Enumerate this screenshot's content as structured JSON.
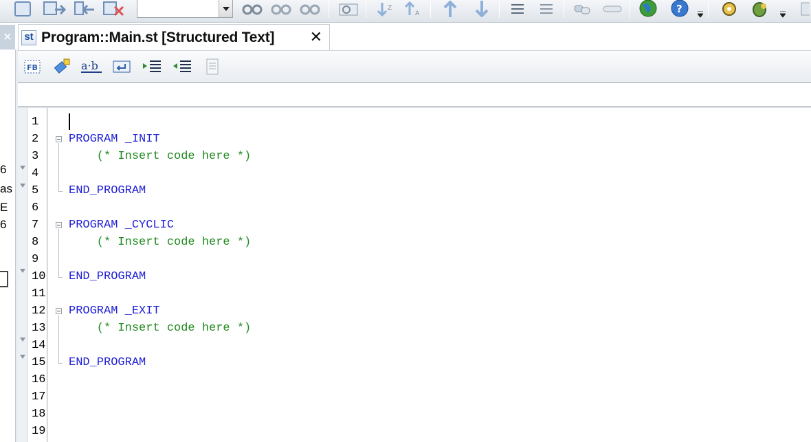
{
  "tab": {
    "icon_text": "st",
    "title": "Program::Main.st [Structured Text]",
    "close_glyph": "✕"
  },
  "left_panel": {
    "close_glyph": "✕",
    "fragments": [
      "6",
      "as",
      "E",
      "6"
    ]
  },
  "toolbar": {
    "combo_value": "",
    "icons": [
      "new-file-icon",
      "open-file-icon",
      "save-file-icon",
      "delete-icon",
      "binoculars-icon",
      "binoculars-next-icon",
      "binoculars-prev-icon",
      "find-replace-icon",
      "sort-asc-icon",
      "sort-desc-icon",
      "arrow-up-icon",
      "arrow-down-icon",
      "align-icon",
      "align-outdent-icon",
      "link-icon",
      "unlink-icon",
      "globe-icon",
      "help-icon",
      "settings-gear-icon",
      "debug-bug-icon"
    ]
  },
  "editor_toolbar": {
    "icons": [
      "function-block-icon",
      "insert-element-icon",
      "ab-rename-icon",
      "wrap-icon",
      "indent-icon",
      "outdent-icon",
      "properties-icon"
    ],
    "fb_label": "FB"
  },
  "field_bar": {
    "value": ""
  },
  "editor": {
    "line_numbers": [
      "1",
      "2",
      "3",
      "4",
      "5",
      "6",
      "7",
      "8",
      "9",
      "10",
      "11",
      "12",
      "13",
      "14",
      "15",
      "16",
      "17",
      "18",
      "19"
    ],
    "lines": [
      {
        "kind": "empty",
        "text": ""
      },
      {
        "kind": "kw",
        "text": "PROGRAM _INIT"
      },
      {
        "kind": "cm",
        "text": "    (* Insert code here *)"
      },
      {
        "kind": "empty",
        "text": ""
      },
      {
        "kind": "kw",
        "text": "END_PROGRAM"
      },
      {
        "kind": "empty",
        "text": ""
      },
      {
        "kind": "kw",
        "text": "PROGRAM _CYCLIC"
      },
      {
        "kind": "cm",
        "text": "    (* Insert code here *)"
      },
      {
        "kind": "empty",
        "text": ""
      },
      {
        "kind": "kw",
        "text": "END_PROGRAM"
      },
      {
        "kind": "empty",
        "text": ""
      },
      {
        "kind": "kw",
        "text": "PROGRAM _EXIT"
      },
      {
        "kind": "cm",
        "text": "    (* Insert code here *)"
      },
      {
        "kind": "empty",
        "text": ""
      },
      {
        "kind": "kw",
        "text": "END_PROGRAM"
      },
      {
        "kind": "empty",
        "text": ""
      },
      {
        "kind": "empty",
        "text": ""
      },
      {
        "kind": "empty",
        "text": ""
      },
      {
        "kind": "empty",
        "text": ""
      }
    ],
    "colors": {
      "keyword": "#1f1fd6",
      "comment": "#1f8a1f"
    }
  }
}
